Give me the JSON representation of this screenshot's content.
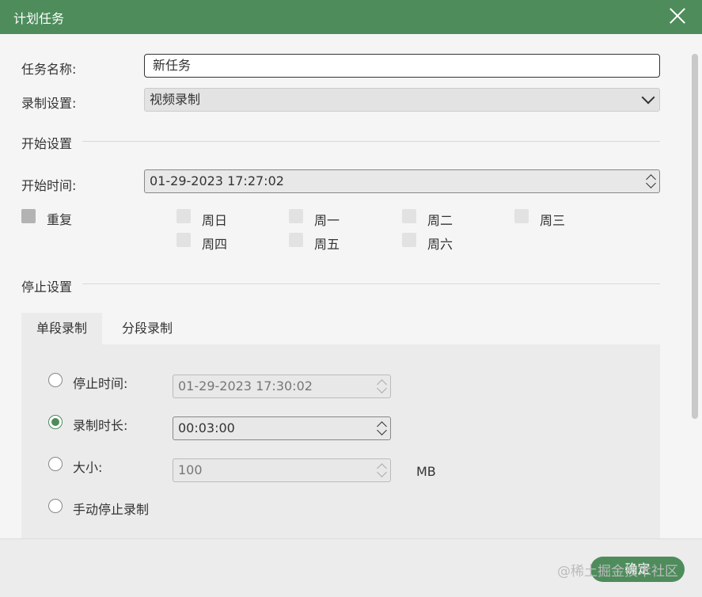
{
  "window": {
    "title": "计划任务"
  },
  "form": {
    "task_name_label": "任务名称:",
    "task_name_value": "新任务",
    "record_settings_label": "录制设置:",
    "record_settings_value": "视频录制",
    "start_section": "开始设置",
    "start_time_label": "开始时间:",
    "start_time_value": "01-29-2023 17:27:02",
    "repeat_label": "重复",
    "days": [
      "周日",
      "周一",
      "周二",
      "周三",
      "周四",
      "周五",
      "周六"
    ],
    "stop_section": "停止设置"
  },
  "tabs": [
    {
      "label": "单段录制",
      "active": true
    },
    {
      "label": "分段录制",
      "active": false
    }
  ],
  "stop_options": {
    "stop_time_label": "停止时间:",
    "stop_time_value": "01-29-2023 17:30:02",
    "duration_label": "录制时长:",
    "duration_value": "00:03:00",
    "size_label": "大小:",
    "size_value": "100",
    "size_unit": "MB",
    "manual_label": "手动停止录制",
    "selected": "duration"
  },
  "footer": {
    "ok_label": "确定",
    "watermark": "@稀土掘金技术社区"
  }
}
